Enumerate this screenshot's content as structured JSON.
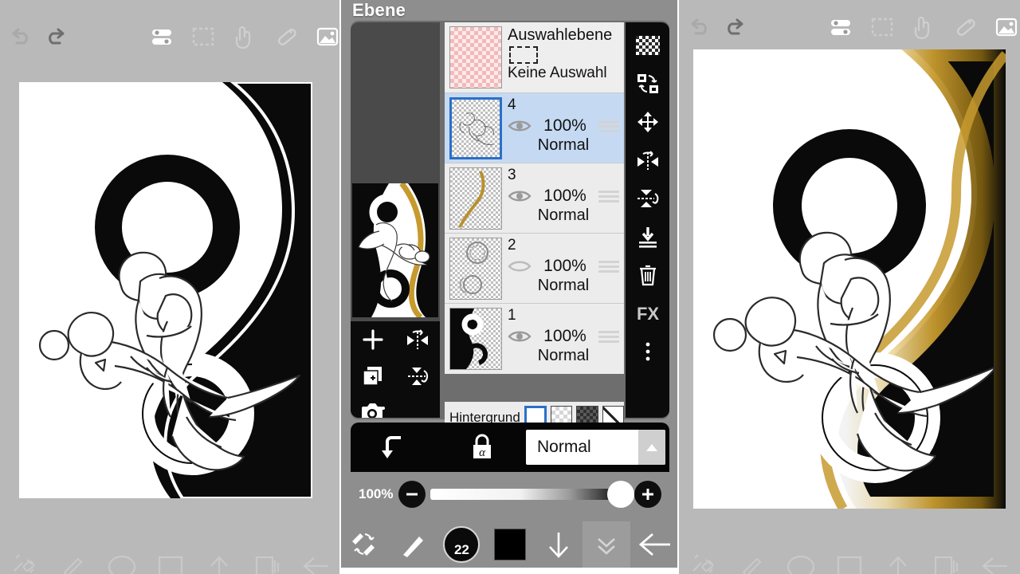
{
  "app": {
    "dialog_title": "Ebene",
    "accent_blue": "#2a6fc9",
    "panel_gray": "#b9b9b9",
    "mid_gray": "#8e8e8e",
    "gold": "#c79a2e"
  },
  "toolbar": {
    "items": [
      {
        "name": "undo-icon",
        "label": "Rückgängig"
      },
      {
        "name": "redo-icon",
        "label": "Wiederholen"
      },
      {
        "name": "settings-sliders-icon",
        "label": "Einstellungen"
      },
      {
        "name": "selection-icon",
        "label": "Auswahl"
      },
      {
        "name": "hand-tool-icon",
        "label": "Hand"
      },
      {
        "name": "ruler-pen-icon",
        "label": "Lineal"
      },
      {
        "name": "image-icon",
        "label": "Bild"
      }
    ]
  },
  "bottom_toolbar": {
    "items": [
      {
        "name": "brush-eraser-swap-icon",
        "label": "Pinsel/Radierer"
      },
      {
        "name": "brush-icon",
        "label": "Pinsel"
      },
      {
        "name": "circle-icon",
        "label": "Kreis"
      },
      {
        "name": "square-icon",
        "label": "Rechteck"
      },
      {
        "name": "arrow-up-icon",
        "label": "Nach oben"
      },
      {
        "name": "layers-icon",
        "label": "Ebenen"
      },
      {
        "name": "back-arrow-icon",
        "label": "Zurück"
      }
    ]
  },
  "layers_panel": {
    "title": "Ebene",
    "selection_layer": {
      "name": "Auswahlebene",
      "status": "Keine Auswahl",
      "thumb": "pink-checker"
    },
    "layers": [
      {
        "id": "4",
        "opacity": "100%",
        "blend": "Normal",
        "selected": true,
        "visible": true,
        "thumb": "sketch-light"
      },
      {
        "id": "3",
        "opacity": "100%",
        "blend": "Normal",
        "selected": false,
        "visible": true,
        "thumb": "gold-curve"
      },
      {
        "id": "2",
        "opacity": "100%",
        "blend": "Normal",
        "selected": false,
        "visible": false,
        "thumb": "circles-light"
      },
      {
        "id": "1",
        "opacity": "100%",
        "blend": "Normal",
        "selected": false,
        "visible": true,
        "thumb": "black-shape"
      }
    ],
    "background": {
      "label": "Hintergrund",
      "options": [
        {
          "name": "bg-white",
          "kind": "white",
          "selected": true
        },
        {
          "name": "bg-transparent-light",
          "kind": "checker-light",
          "selected": false
        },
        {
          "name": "bg-transparent-dark",
          "kind": "checker-dark",
          "selected": false
        },
        {
          "name": "bg-none",
          "kind": "diagonal",
          "selected": false
        }
      ]
    },
    "left_tools": [
      {
        "name": "add-layer-icon",
        "label": "Ebene hinzufügen"
      },
      {
        "name": "flip-horizontal-icon",
        "label": "Horizontal spiegeln"
      },
      {
        "name": "duplicate-layer-icon",
        "label": "Ebene duplizieren"
      },
      {
        "name": "flip-vertical-icon",
        "label": "Vertikal spiegeln"
      },
      {
        "name": "camera-icon",
        "label": "Kamera"
      }
    ],
    "right_tools": [
      {
        "name": "transparency-icon",
        "label": "Transparenz"
      },
      {
        "name": "swap-layers-icon",
        "label": "Ebenen tauschen"
      },
      {
        "name": "move-icon",
        "label": "Verschieben"
      },
      {
        "name": "flip-horizontal-icon",
        "label": "Horizontal spiegeln"
      },
      {
        "name": "flip-vertical-icon",
        "label": "Vertikal spiegeln"
      },
      {
        "name": "merge-down-icon",
        "label": "Nach unten vereinen"
      },
      {
        "name": "trash-icon",
        "label": "Löschen"
      },
      {
        "name": "fx-icon",
        "label": "FX"
      },
      {
        "name": "more-options-icon",
        "label": "Mehr"
      }
    ],
    "blend_bar": {
      "clipping_label": "Clipping",
      "alpha_lock_label": "Alpha-Sperre",
      "blend_mode": "Normal"
    },
    "opacity_bar": {
      "value": "100%",
      "minus": "−",
      "plus": "+"
    }
  },
  "mid_bottom_bar": {
    "brush_size": "22",
    "color": "#000000",
    "items": [
      {
        "name": "brush-eraser-swap-icon",
        "label": "Pinsel/Radierer tauschen"
      },
      {
        "name": "brush-icon",
        "label": "Pinsel"
      },
      {
        "name": "brush-size-button",
        "label": "22"
      },
      {
        "name": "color-swatch-button",
        "label": "Farbe"
      },
      {
        "name": "arrow-down-icon",
        "label": "Herunterladen"
      },
      {
        "name": "chevron-double-down-icon",
        "label": "Einklappen"
      },
      {
        "name": "back-arrow-icon",
        "label": "Zurück"
      }
    ]
  },
  "canvases": {
    "left": {
      "name": "canvas-lineart-bw",
      "description": "Schwarzweiß Lineart"
    },
    "right": {
      "name": "canvas-lineart-gold",
      "description": "Lineart mit Goldakzent"
    },
    "preview": {
      "name": "canvas-preview-thumb",
      "description": "Vorschau"
    }
  }
}
